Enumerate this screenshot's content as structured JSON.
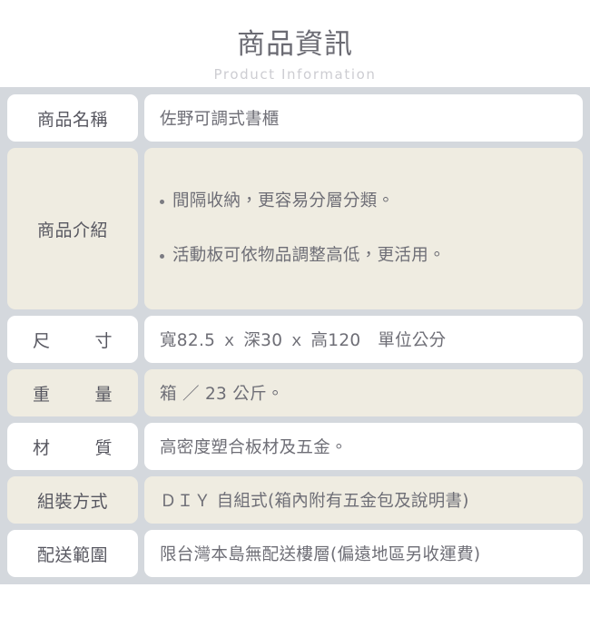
{
  "header": {
    "title": "商品資訊",
    "subtitle": "Product Information"
  },
  "table": {
    "rows": [
      {
        "label": "商品名稱",
        "value": "佐野可調式書櫃"
      },
      {
        "label": "商品介紹",
        "bullets": [
          "間隔收納，更容易分層分類。",
          "活動板可依物品調整高低，更活用。"
        ]
      },
      {
        "label_char_1": "尺",
        "label_char_2": "寸",
        "value": "寬82.5 ｘ 深30 ｘ 高120　單位公分"
      },
      {
        "label_char_1": "重",
        "label_char_2": "量",
        "value": "箱 ／ 23 公斤。"
      },
      {
        "label_char_1": "材",
        "label_char_2": "質",
        "value": "高密度塑合板材及五金。"
      },
      {
        "label": "組裝方式",
        "value": "ＤＩＹ 自組式(箱內附有五金包及說明書)"
      },
      {
        "label": "配送範圍",
        "value": "限台灣本島無配送樓層(偏遠地區另收運費)"
      }
    ]
  },
  "colors": {
    "divider": "#d4d8dd",
    "tint_row": "#efece1",
    "light_row": "#ffffff",
    "label_text": "#575760",
    "value_text": "#6e6e76",
    "title_text": "#6b6b73",
    "subtitle_text": "#cdcdd2"
  }
}
